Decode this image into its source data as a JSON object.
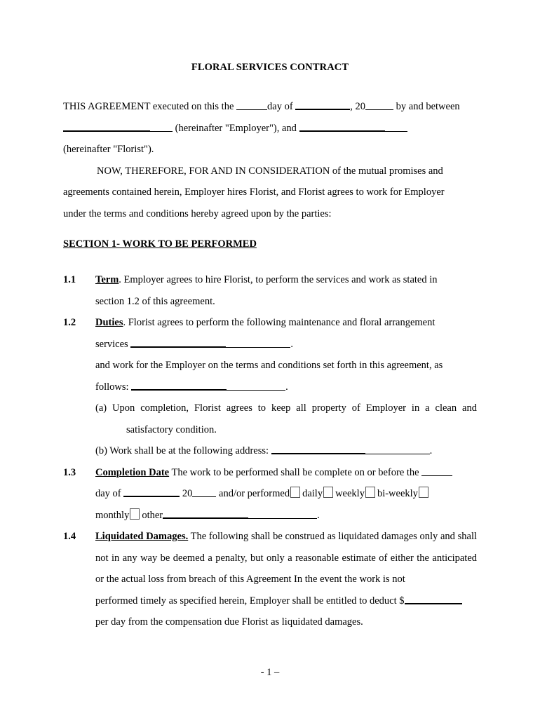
{
  "document": {
    "title": "FLORAL SERVICES CONTRACT",
    "intro": {
      "line1_a": "THIS AGREEMENT executed on this the ",
      "line1_b": "day of ",
      "line1_c": ", 20",
      "line1_d": " by and between",
      "line2_a": " (hereinafter \"Employer\"), and ",
      "line3": "(hereinafter \"Florist\").",
      "para_a": "NOW, THEREFORE, FOR AND IN CONSIDERATION of the mutual promises and",
      "para_b": "agreements contained herein, Employer hires Florist, and Florist agrees to work for Employer",
      "para_c": "under the terms and conditions hereby agreed upon by the parties:"
    },
    "section1": {
      "heading": "SECTION 1- WORK TO BE PERFORMED",
      "clauses": [
        {
          "num": "1.1",
          "label": "Term",
          "text_a": ".  Employer agrees to hire Florist, to perform the services and work as stated in",
          "text_b": "section 1.2 of this agreement."
        },
        {
          "num": "1.2",
          "label": "Duties",
          "text_a": ".   Florist agrees to perform the following maintenance and floral arrangement",
          "text_b": "services ",
          "text_c": ".",
          "text_d": "and work for the Employer on the terms and conditions set forth in this agreement, as",
          "text_e": "follows: ",
          "text_f": ".",
          "sub_a": "(a) Upon completion, Florist agrees to keep all property of Employer in a clean and",
          "sub_a2": "satisfactory condition.",
          "sub_b": "(b) Work shall be at the following address: ",
          "sub_b2": "."
        },
        {
          "num": "1.3",
          "label": "Completion Date",
          "text_a": " The work to be performed shall be complete on or before the ",
          "text_b": "day  of ",
          "text_c": " 20",
          "text_d": " and/or  performed",
          "opt_daily": "daily",
          "opt_weekly": "weekly",
          "opt_biweekly": "bi-weekly",
          "opt_monthly": "monthly",
          "opt_other": "other",
          "text_e": "."
        },
        {
          "num": "1.4",
          "label": "Liquidated Damages.",
          "text_a": "   The following shall be construed as liquidated damages only and",
          "text_b": "shall not in any way be deemed a penalty, but only a reasonable estimate of either the",
          "text_c": "anticipated or the actual loss from breach of this Agreement   In the event the work is not",
          "text_d": "performed timely as specified herein, Employer shall be entitled to deduct $",
          "text_e": "per day from the compensation due Florist as liquidated damages."
        }
      ]
    },
    "footer": {
      "page_label": "- 1 –"
    }
  }
}
